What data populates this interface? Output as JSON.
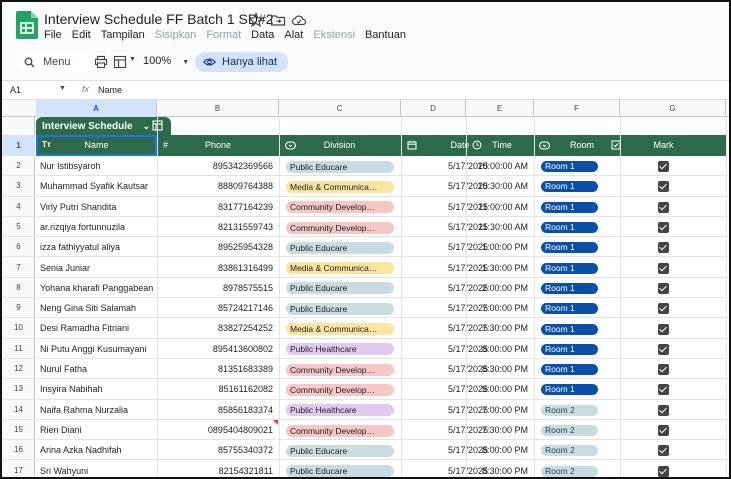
{
  "doc": {
    "title": "Interview Schedule FF Batch 1 SD#2",
    "menus": [
      {
        "label": "File",
        "disabled": false
      },
      {
        "label": "Edit",
        "disabled": false
      },
      {
        "label": "Tampilan",
        "disabled": false
      },
      {
        "label": "Sisipkan",
        "disabled": true
      },
      {
        "label": "Format",
        "disabled": true
      },
      {
        "label": "Data",
        "disabled": false
      },
      {
        "label": "Alat",
        "disabled": false
      },
      {
        "label": "Ekstensi",
        "disabled": true
      },
      {
        "label": "Bantuan",
        "disabled": false
      }
    ]
  },
  "toolbar": {
    "menu_label": "Menu",
    "zoom": "100%",
    "view_only_label": "Hanya lihat"
  },
  "formula_bar": {
    "cell_ref": "A1",
    "fx": "fx",
    "content": "Name"
  },
  "columns": [
    "A",
    "B",
    "C",
    "D",
    "E",
    "F",
    "G"
  ],
  "table": {
    "name": "Interview Schedule",
    "headers": {
      "name": "Name",
      "phone": "Phone",
      "division": "Division",
      "date": "Date",
      "time": "Time",
      "room": "Room",
      "mark": "Mark"
    },
    "rows": [
      {
        "num": "2",
        "name": "Nur Istibsyaroh",
        "phone": "895342369566",
        "division": "Public Educare",
        "date": "5/17/2025",
        "time": "10:00:00 AM",
        "room": "Room 1",
        "mark": true
      },
      {
        "num": "3",
        "name": "Muhammad Syafik Kautsar",
        "phone": "88809764388",
        "division": "Media & Communica…",
        "date": "5/17/2025",
        "time": "10:30:00 AM",
        "room": "Room 1",
        "mark": true
      },
      {
        "num": "4",
        "name": "Virly Putri Shandita",
        "phone": "83177164239",
        "division": "Community Develop…",
        "date": "5/17/2025",
        "time": "11:00:00 AM",
        "room": "Room 1",
        "mark": true
      },
      {
        "num": "5",
        "name": "ar.rizqiya fortunnuzila",
        "phone": "82131559743",
        "division": "Community Develop…",
        "date": "5/17/2025",
        "time": "11:30:00 AM",
        "room": "Room 1",
        "mark": true
      },
      {
        "num": "6",
        "name": "izza fathiyyatul aliya",
        "phone": "89525954328",
        "division": "Public Educare",
        "date": "5/17/2025",
        "time": "1:00:00 PM",
        "room": "Room 1",
        "mark": true
      },
      {
        "num": "7",
        "name": "Senia Juniar",
        "phone": "83861316499",
        "division": "Media & Communica…",
        "date": "5/17/2025",
        "time": "1:30:00 PM",
        "room": "Room 1",
        "mark": true
      },
      {
        "num": "8",
        "name": "Yohana kharafi Panggabean",
        "phone": "8978575515",
        "division": "Public Educare",
        "date": "5/17/2025",
        "time": "2:00:00 PM",
        "room": "Room 1",
        "mark": true
      },
      {
        "num": "9",
        "name": "Neng Gina Siti Salamah",
        "phone": "85724217146",
        "division": "Public Educare",
        "date": "5/17/2025",
        "time": "7:00:00 PM",
        "room": "Room 1",
        "mark": true
      },
      {
        "num": "10",
        "name": "Desi Ramadha Fitriani",
        "phone": "83827254252",
        "division": "Media & Communica…",
        "date": "5/17/2025",
        "time": "7:30:00 PM",
        "room": "Room 1",
        "mark": true
      },
      {
        "num": "11",
        "name": "Ni Putu Anggi Kusumayani",
        "phone": "895413600802",
        "division": "Public Healthcare",
        "date": "5/17/2025",
        "time": "8:00:00 PM",
        "room": "Room 1",
        "mark": true
      },
      {
        "num": "12",
        "name": "Nurul Fatha",
        "phone": "81351683389",
        "division": "Community Develop…",
        "date": "5/17/2025",
        "time": "8:30:00 PM",
        "room": "Room 1",
        "mark": true
      },
      {
        "num": "13",
        "name": "Insyira Nabihah",
        "phone": "85161162082",
        "division": "Community Develop…",
        "date": "5/17/2025",
        "time": "9:00:00 PM",
        "room": "Room 1",
        "mark": true
      },
      {
        "num": "14",
        "name": "Naifa Rahma Nurzalia",
        "phone": "85856183374",
        "division": "Public Healthcare",
        "date": "5/17/2025",
        "time": "7:00:00 PM",
        "room": "Room 2",
        "mark": true
      },
      {
        "num": "15",
        "name": "Rien Diani",
        "phone": "0895404809021",
        "division": "Community Develop…",
        "date": "5/17/2025",
        "time": "7:30:00 PM",
        "room": "Room 2",
        "mark": true,
        "comment": true
      },
      {
        "num": "16",
        "name": "Arina Azka Nadhifah",
        "phone": "85755340372",
        "division": "Public Educare",
        "date": "5/17/2025",
        "time": "8:00:00 PM",
        "room": "Room 2",
        "mark": true
      },
      {
        "num": "17",
        "name": "Sri Wahyuni",
        "phone": "82154321811",
        "division": "Public Educare",
        "date": "5/17/2025",
        "time": "8:30:00 PM",
        "room": "Room 2",
        "mark": true
      }
    ]
  },
  "colors": {
    "table_header_bg": "#2e6b4a",
    "public_educare": "#c9dde0",
    "media_communica": "#fbe5a1",
    "community_develop": "#f6c7c4",
    "public_healthcare": "#e1c9f0",
    "room1_bg": "#0b4fa8",
    "room1_fg": "#ffffff",
    "room2_bg": "#c9dde0",
    "room2_fg": "#1f3f5a"
  }
}
